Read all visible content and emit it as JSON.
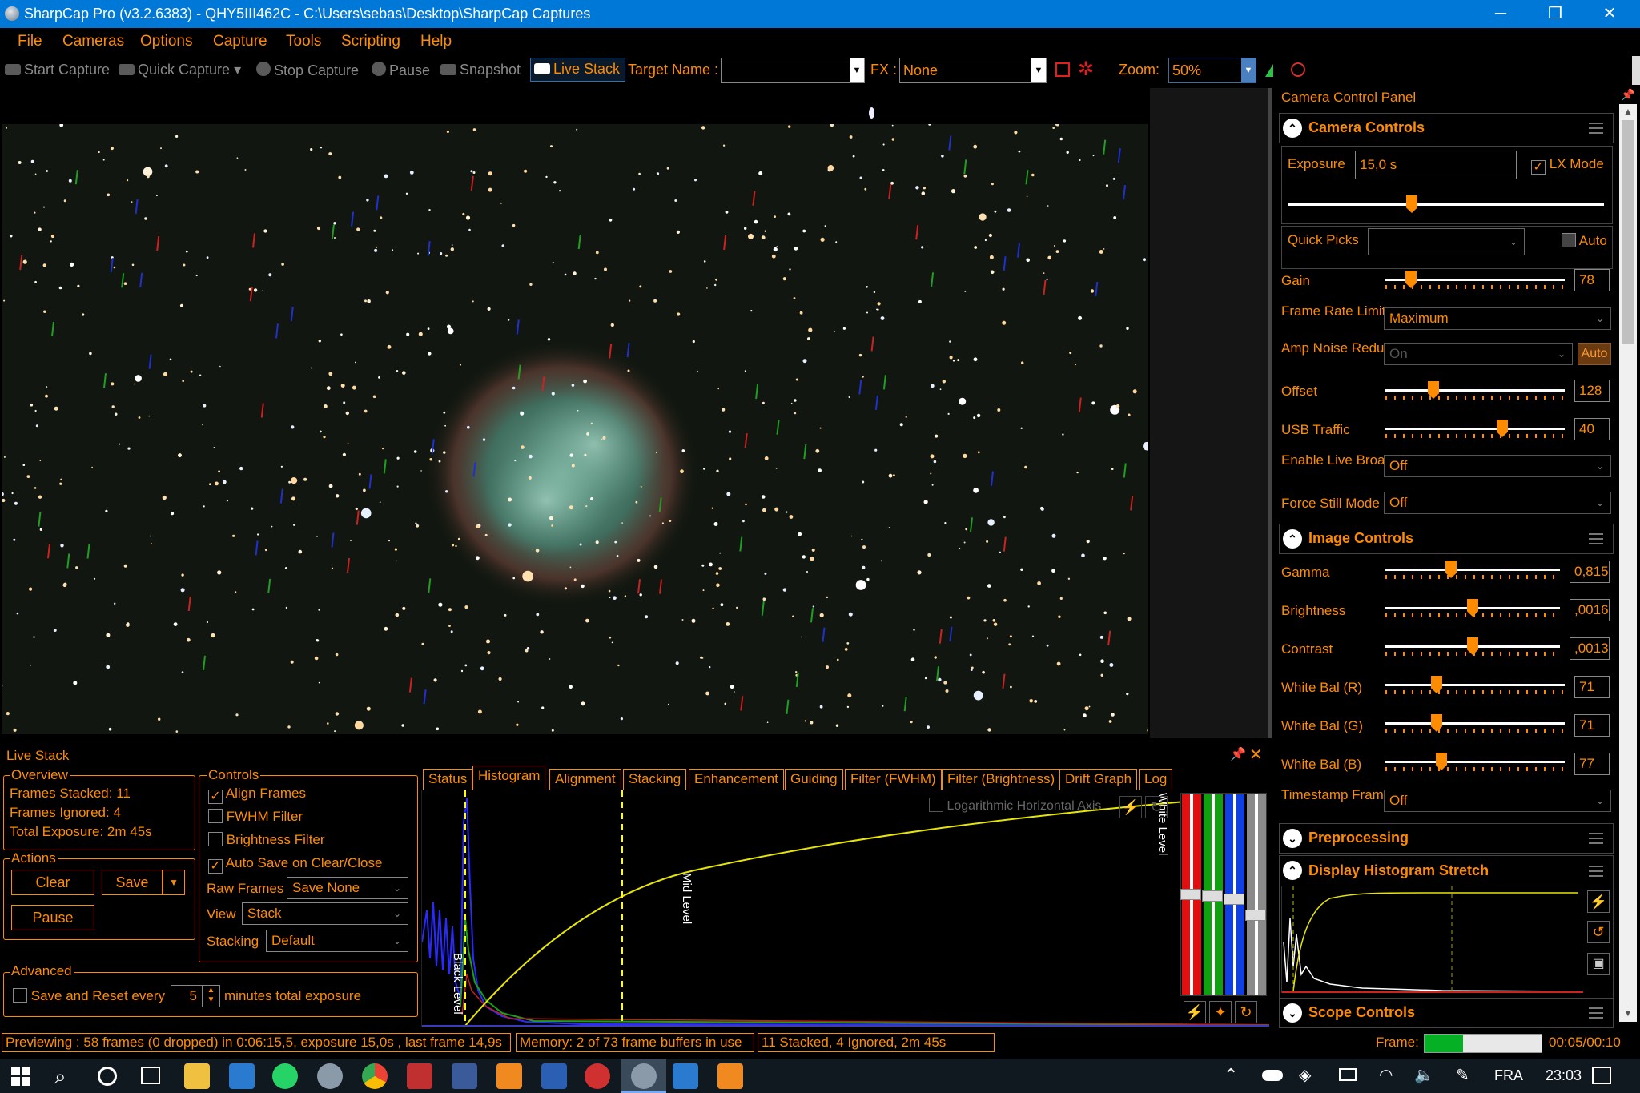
{
  "window": {
    "title": "SharpCap Pro (v3.2.6383) - QHY5III462C - C:\\Users\\sebas\\Desktop\\SharpCap Captures",
    "minimize": "─",
    "maximize": "❐",
    "close": "✕"
  },
  "menu": [
    "File",
    "Cameras",
    "Options",
    "Capture",
    "Tools",
    "Scripting",
    "Help"
  ],
  "toolbar": {
    "start_capture": "Start Capture",
    "quick_capture": "Quick Capture",
    "stop_capture": "Stop Capture",
    "pause": "Pause",
    "snapshot": "Snapshot",
    "live_stack": "Live Stack",
    "target_name_label": "Target Name :",
    "target_name_value": "",
    "fx_label": "FX :",
    "fx_value": "None",
    "zoom_label": "Zoom:",
    "zoom_value": "50%"
  },
  "live_stack": {
    "title": "Live Stack",
    "overview": {
      "title": "Overview",
      "frames_stacked": "Frames Stacked:  11",
      "frames_ignored": "Frames Ignored:  4",
      "total_exposure": "Total Exposure:   2m 45s"
    },
    "actions": {
      "title": "Actions",
      "clear": "Clear",
      "save": "Save",
      "pause": "Pause"
    },
    "controls": {
      "title": "Controls",
      "align_frames": "Align Frames",
      "fwhm_filter": "FWHM Filter",
      "brightness_filter": "Brightness Filter",
      "auto_save": "Auto Save on Clear/Close",
      "raw_frames_label": "Raw Frames",
      "raw_frames_value": "Save None",
      "view_label": "View",
      "view_value": "Stack",
      "stacking_label": "Stacking",
      "stacking_value": "Default"
    },
    "advanced": {
      "title": "Advanced",
      "save_reset": "Save and Reset every",
      "minutes_value": "5",
      "minutes_suffix": "minutes total exposure"
    },
    "tabs": [
      "Status",
      "Histogram",
      "Alignment",
      "Stacking",
      "Enhancement",
      "Guiding",
      "Filter (FWHM)",
      "Filter (Brightness)",
      "Drift Graph",
      "Log"
    ],
    "histogram": {
      "log_axis": "Logarithmic Horizontal Axis",
      "black_level": "Black Level",
      "mid_level": "Mid Level",
      "white_level": "White Level"
    }
  },
  "panel": {
    "title": "Camera Control Panel",
    "camera_controls": {
      "title": "Camera Controls",
      "exposure_label": "Exposure",
      "exposure_value": "15,0 s",
      "lx_mode": "LX Mode",
      "quick_picks": "Quick Picks",
      "auto": "Auto",
      "gain_label": "Gain",
      "gain_value": "78",
      "gain_level": 0.12,
      "frame_rate_label": "Frame Rate Limit",
      "frame_rate_value": "Maximum",
      "amp_noise_label": "Amp Noise Reduction",
      "amp_noise_value": "On",
      "amp_noise_auto": "Auto",
      "offset_label": "Offset",
      "offset_value": "128",
      "offset_level": 0.25,
      "usb_label": "USB Traffic",
      "usb_value": "40",
      "usb_level": 0.66,
      "broadcast_label": "Enable Live Broadcast",
      "broadcast_value": "Off",
      "force_still_label": "Force Still Mode",
      "force_still_value": "Off"
    },
    "image_controls": {
      "title": "Image Controls",
      "gamma_label": "Gamma",
      "gamma_value": "0,815",
      "gamma_level": 0.37,
      "brightness_label": "Brightness",
      "brightness_value": ",0016",
      "brightness_level": 0.5,
      "contrast_label": "Contrast",
      "contrast_value": ",0013",
      "contrast_level": 0.5,
      "wbr_label": "White Bal (R)",
      "wbr_value": "71",
      "wbr_level": 0.27,
      "wbg_label": "White Bal (G)",
      "wbg_value": "71",
      "wbg_level": 0.27,
      "wbb_label": "White Bal (B)",
      "wbb_value": "77",
      "wbb_level": 0.3,
      "timestamp_label": "Timestamp Frames",
      "timestamp_value": "Off"
    },
    "preprocessing": "Preprocessing",
    "display_stretch": "Display Histogram Stretch",
    "scope_controls": "Scope Controls"
  },
  "status": {
    "previewing": "Previewing : 58 frames (0 dropped) in 0:06:15,5, exposure 15,0s , last frame 14,9s",
    "memory": "Memory: 2 of 73 frame buffers in use",
    "stacked": "11 Stacked, 4 Ignored, 2m 45s",
    "frame_label": "Frame:",
    "frame_time": "00:05/00:10",
    "frame_progress": 0.33
  },
  "taskbar": {
    "lang": "FRA",
    "time": "23:03"
  }
}
